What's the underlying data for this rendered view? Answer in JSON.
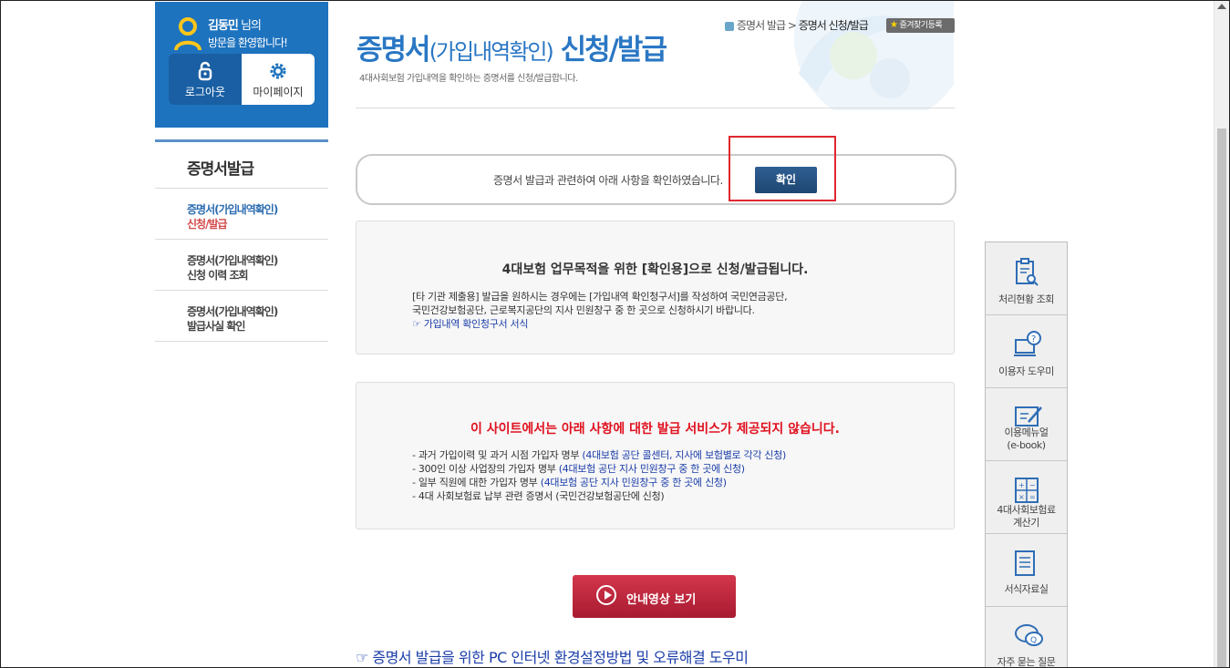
{
  "user": {
    "name": "김동민",
    "name_suffix": " 님의",
    "welcome": "방문을 환영합니다!",
    "logout_label": "로그아웃",
    "mypage_label": "마이페이지"
  },
  "nav": {
    "title": "증명서발급",
    "items": [
      {
        "line1": "증명서(가입내역확인)",
        "line2": "신청/발급"
      },
      {
        "line1": "증명서(가입내역확인)",
        "line2": "신청 이력 조회"
      },
      {
        "line1": "증명서(가입내역확인)",
        "line2": "발급사실 확인"
      }
    ]
  },
  "header": {
    "title_main": "증명서",
    "title_paren": "(가입내역확인)",
    "title_tail": " 신청/발급",
    "description": "4대사회보험 가입내역을 확인하는 증명서를 신청/발급합니다.",
    "breadcrumb_1": "증명서 발급",
    "breadcrumb_sep": " > ",
    "breadcrumb_2": "증명서 신청/발급",
    "favorite_label": "즐겨찾기등록"
  },
  "confirm": {
    "text": "증명서 발급과 관련하여 아래 사항을 확인하였습니다.",
    "button_label": "확인"
  },
  "box1": {
    "heading": "4대보험 업무목적을 위한 [확인용]으로 신청/발급됩니다.",
    "line1": "[타 기관 제출용] 발급을 원하시는 경우에는 [가입내역 확인청구서]를 작성하여 국민연금공단,",
    "line2": "국민건강보험공단, 근로복지공단의 지사 민원창구 중 한 곳으로 신청하시기 바랍니다.",
    "link": "☞ 가입내역 확인청구서 서식"
  },
  "box2": {
    "heading": "이 사이트에서는 아래 사항에 대한 발급 서비스가 제공되지 않습니다.",
    "items": [
      {
        "text": "- 과거 가입이력 및 과거 시점 가입자 명부 ",
        "note": "(4대보험 공단 콜센터, 지사에 보험별로 각각 신청)"
      },
      {
        "text": "- 300인 이상 사업장의 가입자 명부 ",
        "note": "(4대보험 공단 지사 민원창구 중 한 곳에 신청)"
      },
      {
        "text": "- 일부 직원에 대한 가입자 명부 ",
        "note": "(4대보험 공단 지사 민원창구 중 한 곳에 신청)"
      },
      {
        "text": "- 4대 사회보험료 납부 관련 증명서 (국민건강보험공단에 신청)",
        "note": ""
      }
    ]
  },
  "video_button": "안내영상 보기",
  "help_link": "☞ 증명서 발급을 위한 PC 인터넷 환경설정방법 및 오류해결 도우미",
  "quick_menu": [
    {
      "line1": "처리현황 조회",
      "line2": "",
      "icon": "clipboard-search-icon"
    },
    {
      "line1": "이용자 도우미",
      "line2": "",
      "icon": "monitor-help-icon"
    },
    {
      "line1": "이용메뉴얼",
      "line2": "(e-book)",
      "icon": "manual-edit-icon"
    },
    {
      "line1": "4대사회보험료",
      "line2": "계산기",
      "icon": "calculator-icon"
    },
    {
      "line1": "서식자료실",
      "line2": "",
      "icon": "document-list-icon"
    },
    {
      "line1": "자주 묻는 질문",
      "line2": "",
      "icon": "chat-faq-icon"
    }
  ],
  "colors": {
    "primary_blue": "#1e73be",
    "title_blue": "#2a77c4",
    "alert_red": "#e0101e",
    "video_red": "#c0243a",
    "highlight_red": "#e0272f"
  }
}
